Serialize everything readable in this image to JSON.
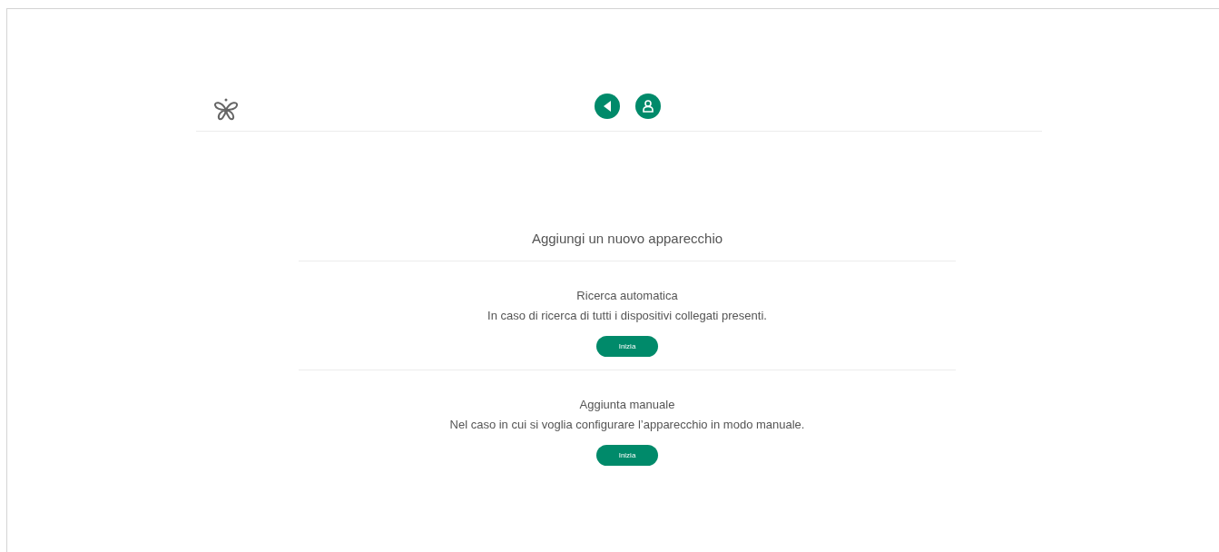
{
  "title": "Aggiungi un nuovo apparecchio",
  "options": [
    {
      "heading": "Ricerca automatica",
      "description": "In caso di ricerca di tutti i dispositivi collegati presenti.",
      "button": "Inizia"
    },
    {
      "heading": "Aggiunta manuale",
      "description": "Nel caso in cui si voglia configurare l’apparecchio in modo manuale.",
      "button": "Inizia"
    }
  ]
}
